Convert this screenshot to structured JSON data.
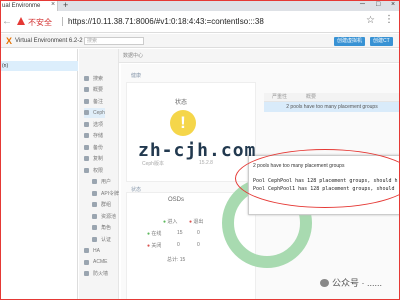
{
  "browser": {
    "tab_title": "ual Environme",
    "unsafe_label": "不安全",
    "url": "https://10.11.38.71:8006/#v1:0:18:4:43:=contentIso:::38",
    "icons": [
      "back-arrow-icon",
      "warning-icon",
      "star-icon",
      "menu-icon",
      "close-icon",
      "new-tab-icon"
    ]
  },
  "pve": {
    "logo": "X",
    "title": "Virtual Environment 6.2-2",
    "search_placeholder": "搜索",
    "buttons": [
      "创建虚拟机",
      "创建CT"
    ]
  },
  "tree": {
    "selected": "(n)"
  },
  "nav": {
    "header": "数据中心",
    "items": [
      {
        "label": "搜索",
        "sub": false
      },
      {
        "label": "概要",
        "sub": false
      },
      {
        "label": "备注",
        "sub": false
      },
      {
        "label": "Ceph",
        "sub": false,
        "selected": true
      },
      {
        "label": "选项",
        "sub": false
      },
      {
        "label": "存储",
        "sub": false
      },
      {
        "label": "备份",
        "sub": false
      },
      {
        "label": "复制",
        "sub": false
      },
      {
        "label": "权限",
        "sub": false
      },
      {
        "label": "用户",
        "sub": true
      },
      {
        "label": "API令牌",
        "sub": true
      },
      {
        "label": "群组",
        "sub": true
      },
      {
        "label": "资源池",
        "sub": true
      },
      {
        "label": "角色",
        "sub": true
      },
      {
        "label": "认证",
        "sub": true
      },
      {
        "label": "HA",
        "sub": false
      },
      {
        "label": "ACME",
        "sub": false
      },
      {
        "label": "防火墙",
        "sub": false
      }
    ]
  },
  "health": {
    "section_title": "健康",
    "status_label": "状态",
    "ceph_version_label": "Ceph版本",
    "ceph_version": "15.2.8",
    "table_headers": [
      "严重性",
      "概要"
    ],
    "warning_row": "2 pools have too many placement groups"
  },
  "status_section": {
    "title": "状态",
    "osd_title": "OSDs",
    "in_label": "进入",
    "out_label": "退出",
    "up_label": "在线",
    "down_label": "关闭",
    "up_in": "15",
    "up_out": "0",
    "down_in": "0",
    "down_out": "0",
    "total": "总计: 15"
  },
  "popup": {
    "heading": "2 pools have too many placement groups",
    "lines": [
      "Pool CephPool has 128 placement groups, should h",
      "Pool CephPool1 has 128 placement groups, should"
    ]
  },
  "watermark": "zh-cjh.com",
  "wechat_label": "公众号 · ......"
}
